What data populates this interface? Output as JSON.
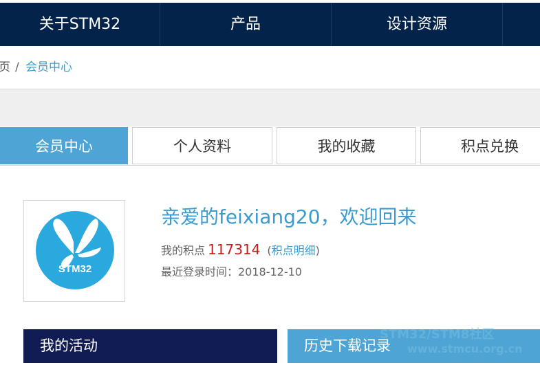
{
  "topnav": {
    "items": [
      "关于STM32",
      "产品",
      "设计资源"
    ]
  },
  "breadcrumb": {
    "home": "页",
    "separator": "/",
    "current": "会员中心"
  },
  "tabs": [
    "会员中心",
    "个人资料",
    "我的收藏",
    "积点兑换"
  ],
  "active_tab": "会员中心",
  "profile": {
    "logo_text": "STM32",
    "welcome": "亲爱的feixiang20，欢迎回来",
    "points_label": "我的积点",
    "points_value": "117314",
    "points_link_open": "(",
    "points_link": "积点明细",
    "points_link_close": ")",
    "last_login": "最近登录时间：2018-12-10"
  },
  "sections": {
    "activity": "我的活动",
    "downloads": "历史下载记录"
  },
  "watermark": {
    "line1": "STM32/STM8社区",
    "line2": "www.stmcu.org.cn"
  },
  "colors": {
    "nav_bg": "#03234b",
    "tab_active": "#4ea5d5",
    "section_dark": "#121c54",
    "points_red": "#c81a1a",
    "link_blue": "#3a9bcf"
  }
}
